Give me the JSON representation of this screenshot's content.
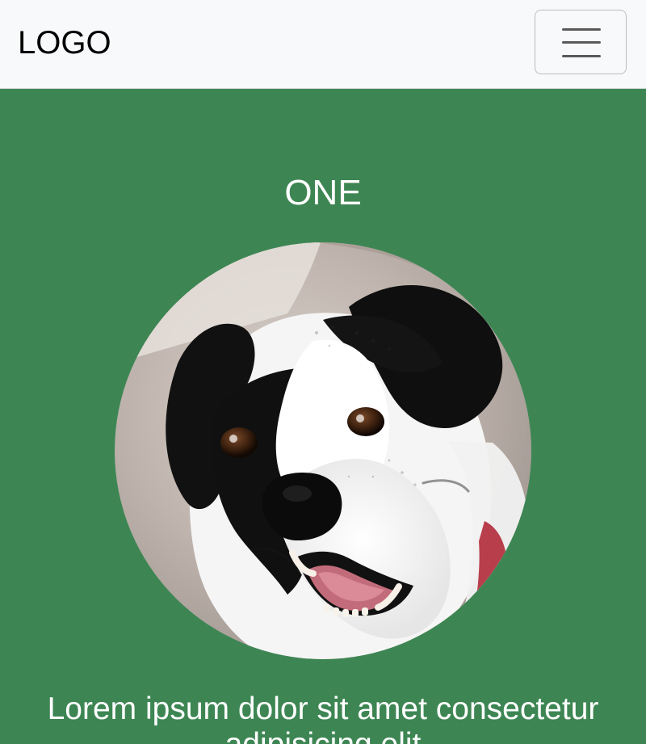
{
  "navbar": {
    "logo": "LOGO",
    "toggler_icon": "hamburger-menu-icon"
  },
  "section": {
    "heading": "ONE",
    "lead": "Lorem ipsum dolor sit amet consectetur adipisicing elit",
    "background_color": "#3d8653",
    "image_subject": "dog"
  }
}
